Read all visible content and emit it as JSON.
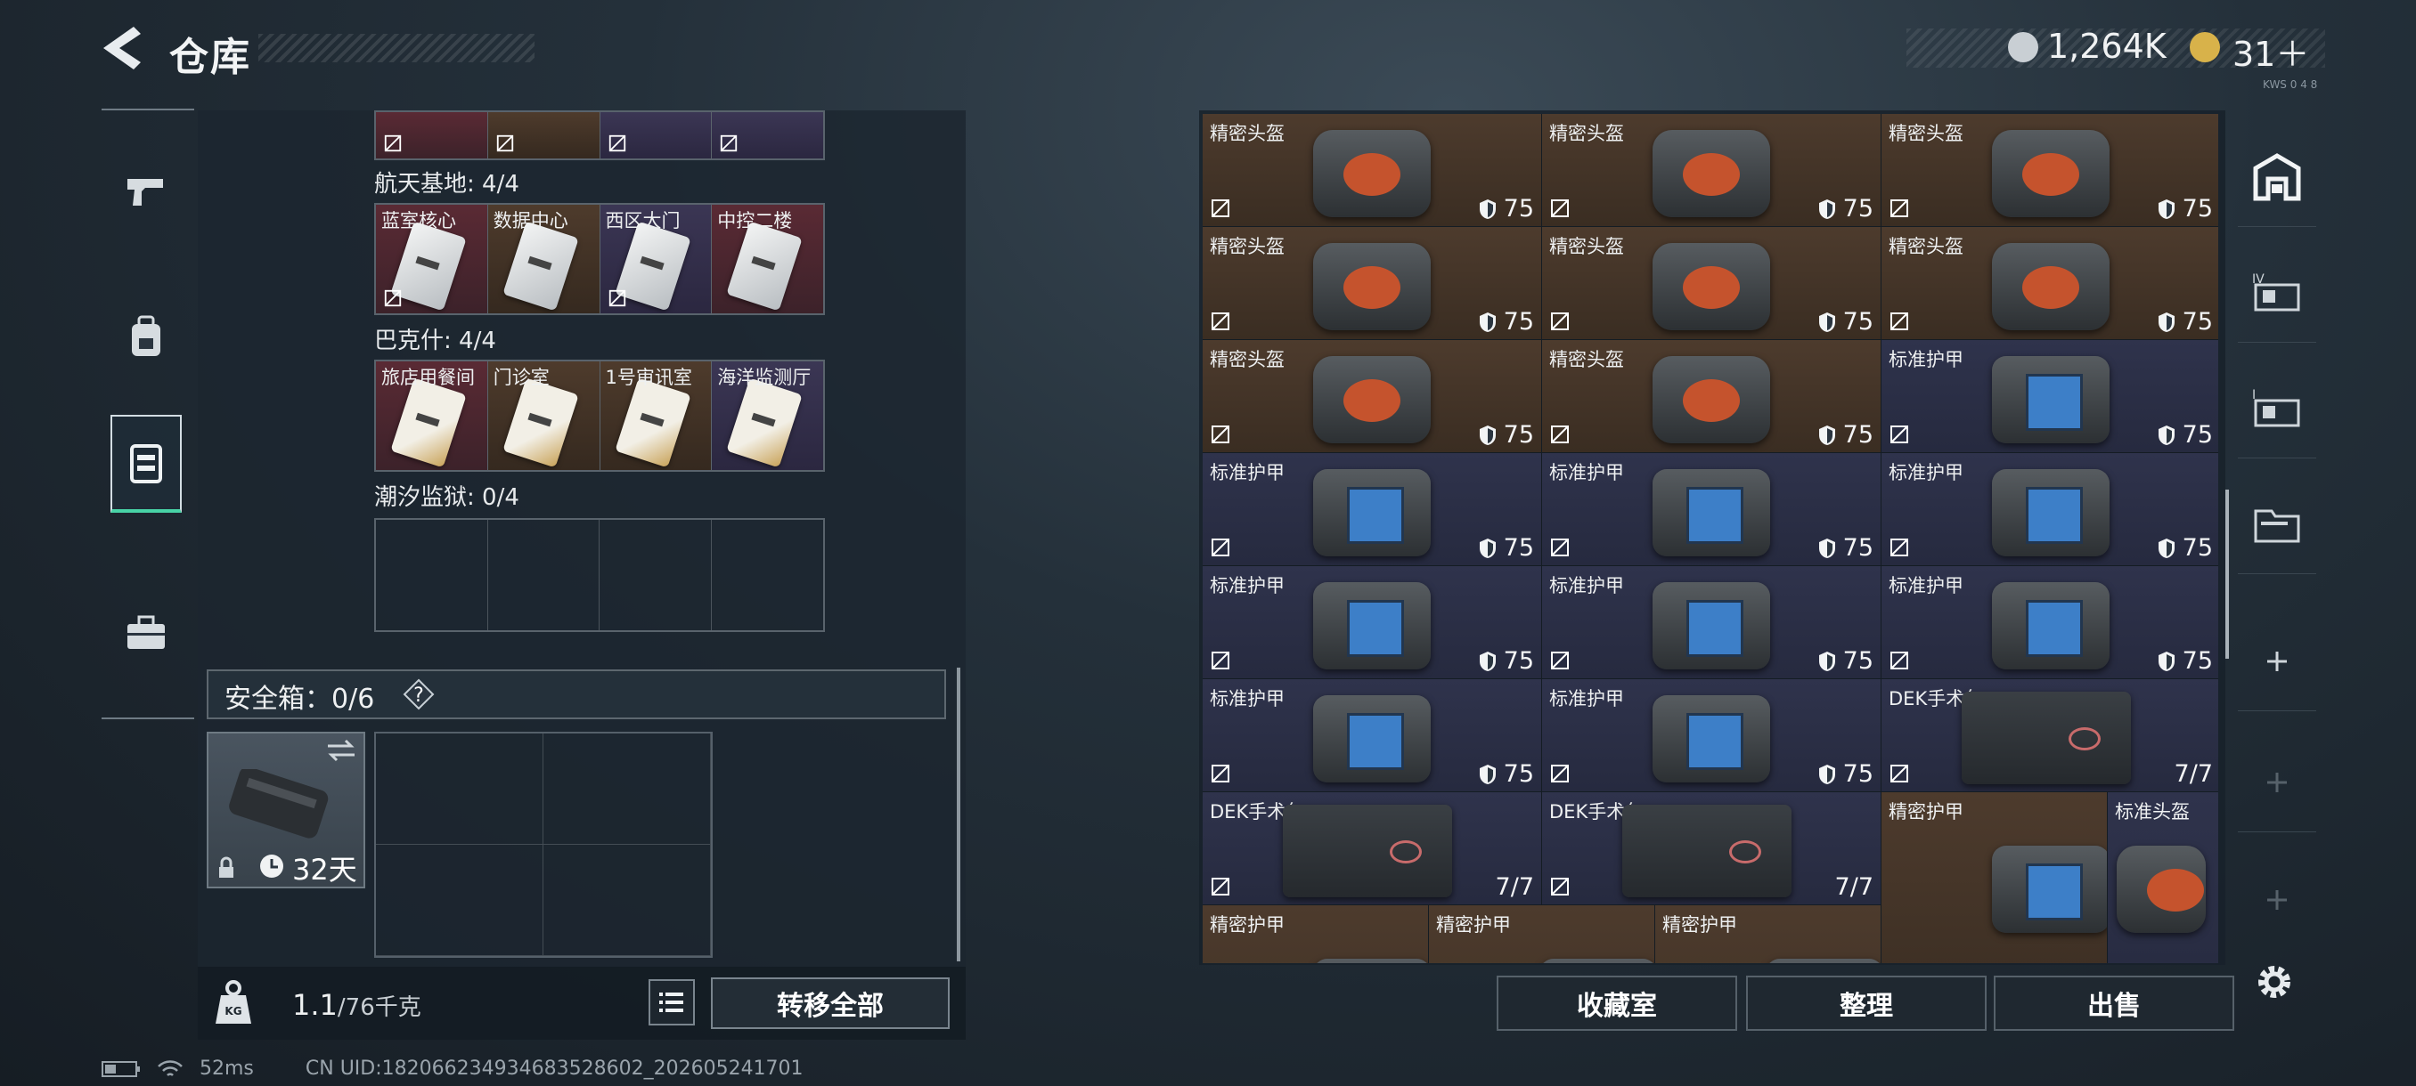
{
  "header": {
    "title": "仓库",
    "coin_value": "1,264K",
    "tickets_value": "31＋",
    "version": "KWS 0 4 8"
  },
  "left_rail": {
    "items": [
      "weapon-tab",
      "backpack-tab",
      "storage-tab",
      "toolbox-tab"
    ],
    "active": "storage-tab"
  },
  "keycards": {
    "groups": [
      {
        "label": "航天基地: 4/4",
        "cards": [
          "蓝室核心",
          "数据中心",
          "西区大门",
          "中控二楼"
        ],
        "colors": [
          "red",
          "brown",
          "purple",
          "red"
        ]
      },
      {
        "label": "巴克什: 4/4",
        "cards": [
          "旅店用餐间",
          "门诊室",
          "1号审讯室",
          "海洋监测厅"
        ],
        "colors": [
          "red",
          "brown",
          "brown",
          "purple"
        ]
      },
      {
        "label": "潮汐监狱: 0/4",
        "cards": [
          "",
          "",
          "",
          ""
        ],
        "colors": [
          "empty",
          "empty",
          "empty",
          "empty"
        ]
      }
    ]
  },
  "safebox": {
    "label": "安全箱：0/6",
    "help": "?",
    "timer": "32天"
  },
  "footer": {
    "weight_value": "1.1",
    "weight_max": "/76千克",
    "weight_icon_text": "KG",
    "transfer_all": "转移全部"
  },
  "status": {
    "ping": "52ms",
    "uid": "CN UID:182066234934683528602_202605241701"
  },
  "inventory": {
    "items": [
      {
        "name": "精密头盔",
        "type": "helmet",
        "color": "brown",
        "value": "75"
      },
      {
        "name": "精密头盔",
        "type": "helmet",
        "color": "brown",
        "value": "75"
      },
      {
        "name": "精密头盔",
        "type": "helmet",
        "color": "brown",
        "value": "75"
      },
      {
        "name": "精密头盔",
        "type": "helmet",
        "color": "brown",
        "value": "75"
      },
      {
        "name": "精密头盔",
        "type": "helmet",
        "color": "brown",
        "value": "75"
      },
      {
        "name": "精密头盔",
        "type": "helmet",
        "color": "brown",
        "value": "75"
      },
      {
        "name": "精密头盔",
        "type": "helmet",
        "color": "brown",
        "value": "75"
      },
      {
        "name": "精密头盔",
        "type": "helmet",
        "color": "brown",
        "value": "75"
      },
      {
        "name": "标准护甲",
        "type": "vest",
        "color": "blue",
        "value": "75"
      },
      {
        "name": "标准护甲",
        "type": "vest",
        "color": "blue",
        "value": "75"
      },
      {
        "name": "标准护甲",
        "type": "vest",
        "color": "blue",
        "value": "75"
      },
      {
        "name": "标准护甲",
        "type": "vest",
        "color": "blue",
        "value": "75"
      },
      {
        "name": "标准护甲",
        "type": "vest",
        "color": "blue",
        "value": "75"
      },
      {
        "name": "标准护甲",
        "type": "vest",
        "color": "blue",
        "value": "75"
      },
      {
        "name": "标准护甲",
        "type": "vest",
        "color": "blue",
        "value": "75"
      },
      {
        "name": "标准护甲",
        "type": "vest",
        "color": "blue",
        "value": "75"
      },
      {
        "name": "标准护甲",
        "type": "vest",
        "color": "blue",
        "value": "75"
      },
      {
        "name": "DEK手术包",
        "type": "kit",
        "color": "blue",
        "value": "7/7"
      },
      {
        "name": "DEK手术包",
        "type": "kit",
        "color": "blue",
        "value": "7/7"
      },
      {
        "name": "DEK手术包",
        "type": "kit",
        "color": "blue",
        "value": "7/7"
      },
      {
        "name": "精密护甲",
        "type": "vest",
        "color": "brown",
        "value": ""
      },
      {
        "name": "标准头盔",
        "type": "helmet",
        "color": "blue",
        "value": ""
      },
      {
        "name": "精密护甲",
        "type": "vest",
        "color": "brown",
        "value": ""
      },
      {
        "name": "精密护甲",
        "type": "vest",
        "color": "brown",
        "value": ""
      },
      {
        "name": "精密护甲",
        "type": "vest",
        "color": "brown",
        "value": ""
      }
    ]
  },
  "actions": {
    "collection": "收藏室",
    "tidy": "整理",
    "sell": "出售"
  }
}
